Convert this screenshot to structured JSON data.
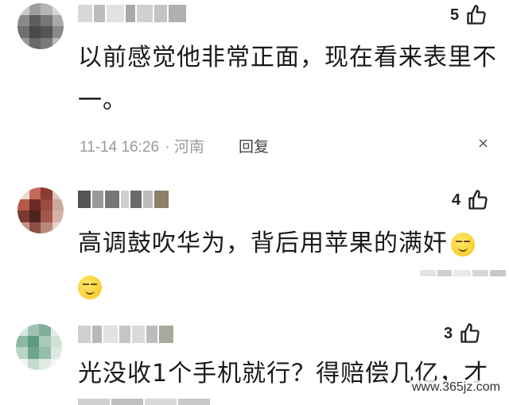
{
  "comments": [
    {
      "likes": "5",
      "text_line1": "以前感觉他非常正面，现在看来表里不",
      "text_line2": "一。",
      "time": "11-14 16:26",
      "location": "河南",
      "reply_label": "回复",
      "close_glyph": "×"
    },
    {
      "likes": "4",
      "text_line1": "高调鼓吹华为，背后用苹果的满奸",
      "text_line2": ""
    },
    {
      "likes": "3",
      "text_line1": "光没收1个手机就行？得赔偿几亿，才"
    }
  ],
  "watermark": "www.365jz.com",
  "icons": {
    "like": "thumbs-up-icon",
    "emoji": "smirk-emoji-icon",
    "close": "close-icon"
  },
  "colors": {
    "meta_text": "#9a9a9a",
    "emoji": "#f6c21c"
  }
}
